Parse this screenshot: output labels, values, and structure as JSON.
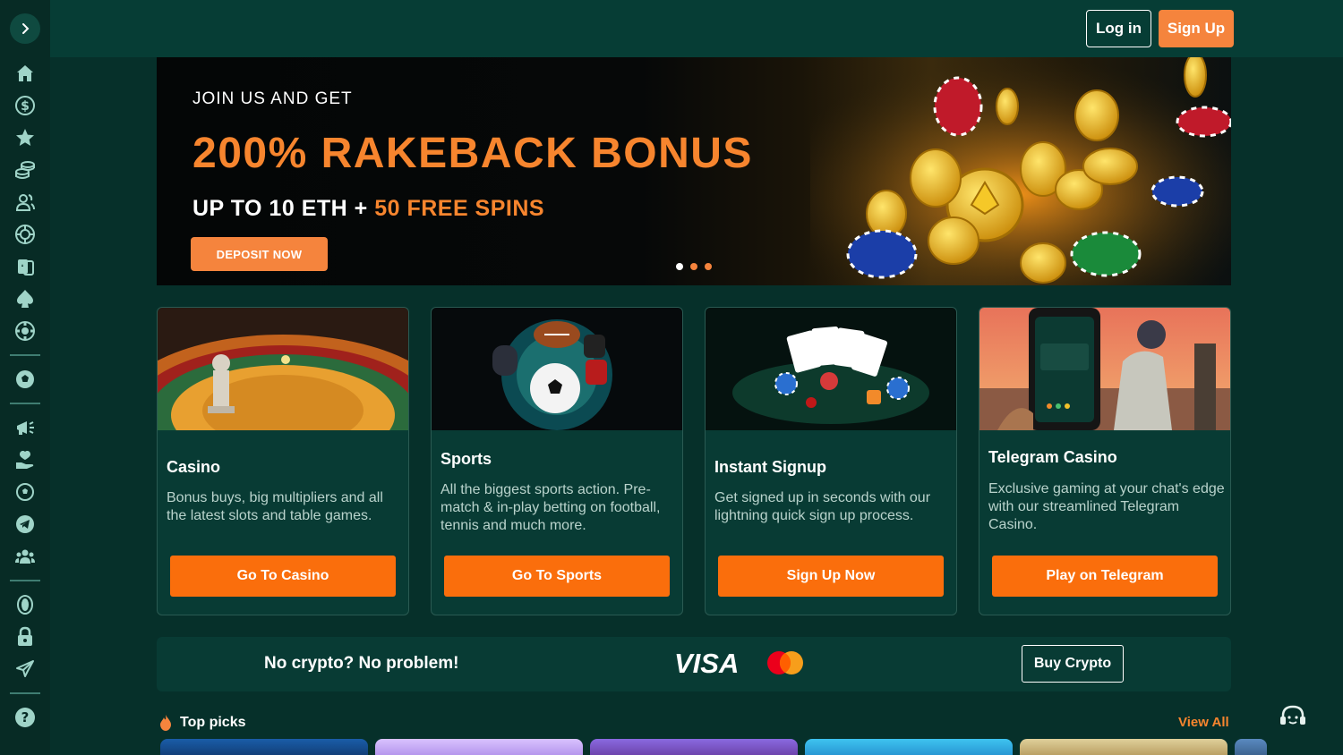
{
  "topbar": {
    "login_label": "Log in",
    "signup_label": "Sign Up"
  },
  "sidebar": {
    "items": [
      {
        "name": "home-icon"
      },
      {
        "name": "dollar-icon"
      },
      {
        "name": "star-icon"
      },
      {
        "name": "coins-icon"
      },
      {
        "name": "users-icon"
      },
      {
        "name": "wheel-icon"
      },
      {
        "name": "cards-icon"
      },
      {
        "name": "spade-icon"
      },
      {
        "name": "chip-icon"
      },
      {
        "name": "football-icon"
      },
      {
        "name": "megaphone-icon"
      },
      {
        "name": "hand-heart-icon"
      },
      {
        "name": "soccer-ball-icon"
      },
      {
        "name": "telegram-icon"
      },
      {
        "name": "community-icon"
      },
      {
        "name": "coin-icon"
      },
      {
        "name": "lock-icon"
      },
      {
        "name": "plane-icon"
      },
      {
        "name": "help-icon"
      }
    ]
  },
  "hero": {
    "eyebrow": "JOIN US AND GET",
    "title": "200% RAKEBACK BONUS",
    "subtitle_main": "UP TO 10 ETH + ",
    "subtitle_accent": "50 FREE SPINS",
    "cta": "DEPOSIT NOW",
    "dots": 3,
    "active_dot": 0
  },
  "cards": [
    {
      "title": "Casino",
      "description": "Bonus buys, big multipliers and all the latest slots and table games.",
      "button": "Go To Casino"
    },
    {
      "title": "Sports",
      "description": "All the biggest sports action. Pre-match & in-play betting on football, tennis and much more.",
      "button": "Go To Sports"
    },
    {
      "title": "Instant Signup",
      "description": "Get signed up in seconds with our lightning quick sign up process.",
      "button": "Sign Up Now"
    },
    {
      "title": "Telegram Casino",
      "description": "Exclusive gaming at your chat's edge with our streamlined Telegram Casino.",
      "button": "Play on Telegram"
    }
  ],
  "crypto": {
    "text": "No crypto? No problem!",
    "visa": "VISA",
    "button": "Buy Crypto"
  },
  "top_picks": {
    "title": "Top picks",
    "view_all": "View All"
  },
  "colors": {
    "accent": "#f5843d",
    "bg": "#06302a",
    "card": "#083b34",
    "button": "#fa6e0c"
  }
}
